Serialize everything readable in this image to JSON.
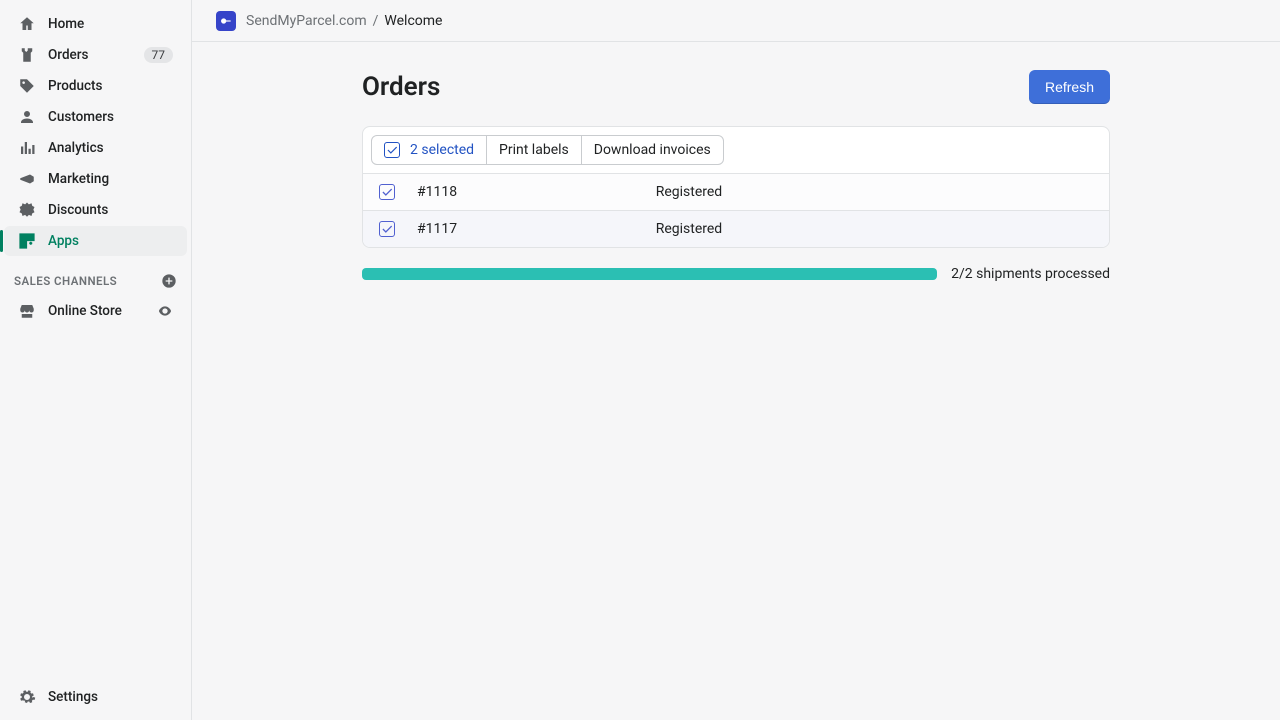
{
  "sidebar": {
    "items": [
      {
        "key": "home",
        "label": "Home"
      },
      {
        "key": "orders",
        "label": "Orders",
        "badge": "77"
      },
      {
        "key": "products",
        "label": "Products"
      },
      {
        "key": "customers",
        "label": "Customers"
      },
      {
        "key": "analytics",
        "label": "Analytics"
      },
      {
        "key": "marketing",
        "label": "Marketing"
      },
      {
        "key": "discounts",
        "label": "Discounts"
      },
      {
        "key": "apps",
        "label": "Apps",
        "active": true
      }
    ],
    "section_heading": "SALES CHANNELS",
    "channels": [
      {
        "key": "online-store",
        "label": "Online Store"
      }
    ],
    "settings_label": "Settings"
  },
  "breadcrumb": {
    "app_name": "SendMyParcel.com",
    "separator": "/",
    "page": "Welcome"
  },
  "page": {
    "title": "Orders",
    "refresh_label": "Refresh"
  },
  "action_bar": {
    "selection_text": "2 selected",
    "print_labels": "Print labels",
    "download_invoices": "Download invoices"
  },
  "orders": [
    {
      "id": "#1118",
      "status": "Registered"
    },
    {
      "id": "#1117",
      "status": "Registered"
    }
  ],
  "progress": {
    "text": "2/2 shipments processed"
  }
}
